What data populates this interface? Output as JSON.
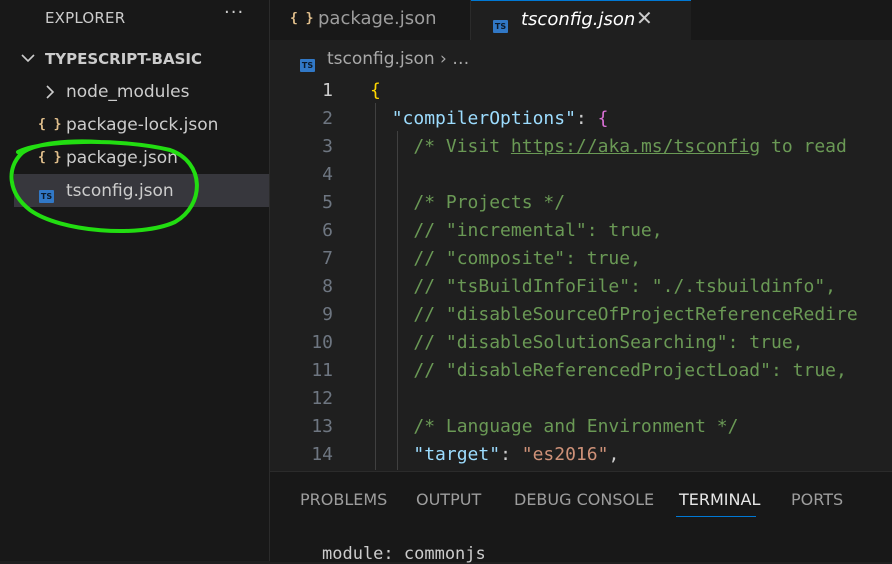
{
  "explorer": {
    "title": "EXPLORER",
    "more": "···",
    "folder": "TYPESCRIPT-BASIC",
    "items": [
      {
        "label": "node_modules",
        "type": "folder"
      },
      {
        "label": "package-lock.json",
        "type": "json"
      },
      {
        "label": "package.json",
        "type": "json"
      },
      {
        "label": "tsconfig.json",
        "type": "ts",
        "selected": true
      }
    ],
    "json_icon": "{ }",
    "ts_icon": "TS"
  },
  "tabs": [
    {
      "label": "package.json",
      "icon": "{ }"
    },
    {
      "label": "tsconfig.json",
      "icon": "TS",
      "active": true,
      "close": "✕"
    }
  ],
  "breadcrumb": {
    "file": "tsconfig.json",
    "sep": "› …"
  },
  "editor": {
    "line_numbers": [
      "1",
      "2",
      "3",
      "4",
      "5",
      "6",
      "7",
      "8",
      "9",
      "10",
      "11",
      "12",
      "13",
      "14"
    ],
    "lines": [
      {
        "parts": [
          {
            "t": "{",
            "c": "c-brace"
          }
        ]
      },
      {
        "parts": [
          {
            "t": "  "
          },
          {
            "t": "\"compilerOptions\"",
            "c": "c-key"
          },
          {
            "t": ": "
          },
          {
            "t": "{",
            "c": "c-brace2"
          }
        ]
      },
      {
        "parts": [
          {
            "t": "    "
          },
          {
            "t": "/* Visit ",
            "c": "c-com"
          },
          {
            "t": "https://aka.ms/tsconfig",
            "c": "c-link"
          },
          {
            "t": " to read",
            "c": "c-com"
          }
        ]
      },
      {
        "parts": [
          {
            "t": ""
          }
        ]
      },
      {
        "parts": [
          {
            "t": "    "
          },
          {
            "t": "/* Projects */",
            "c": "c-com"
          }
        ]
      },
      {
        "parts": [
          {
            "t": "    "
          },
          {
            "t": "// \"incremental\": true,",
            "c": "c-com"
          }
        ]
      },
      {
        "parts": [
          {
            "t": "    "
          },
          {
            "t": "// \"composite\": true,",
            "c": "c-com"
          }
        ]
      },
      {
        "parts": [
          {
            "t": "    "
          },
          {
            "t": "// \"tsBuildInfoFile\": \"./.tsbuildinfo\",",
            "c": "c-com"
          }
        ]
      },
      {
        "parts": [
          {
            "t": "    "
          },
          {
            "t": "// \"disableSourceOfProjectReferenceRedire",
            "c": "c-com"
          }
        ]
      },
      {
        "parts": [
          {
            "t": "    "
          },
          {
            "t": "// \"disableSolutionSearching\": true,",
            "c": "c-com"
          }
        ]
      },
      {
        "parts": [
          {
            "t": "    "
          },
          {
            "t": "// \"disableReferencedProjectLoad\": true,",
            "c": "c-com"
          }
        ]
      },
      {
        "parts": [
          {
            "t": ""
          }
        ]
      },
      {
        "parts": [
          {
            "t": "    "
          },
          {
            "t": "/* Language and Environment */",
            "c": "c-com"
          }
        ]
      },
      {
        "parts": [
          {
            "t": "    "
          },
          {
            "t": "\"target\"",
            "c": "c-key"
          },
          {
            "t": ": "
          },
          {
            "t": "\"es2016\"",
            "c": "c-str"
          },
          {
            "t": ","
          }
        ]
      }
    ]
  },
  "panel": {
    "tabs": [
      "PROBLEMS",
      "OUTPUT",
      "DEBUG CONSOLE",
      "TERMINAL",
      "PORTS"
    ],
    "active": "TERMINAL",
    "terminal_line": "module: commonjs"
  },
  "colors": {
    "accent": "#0078d4",
    "annotation": "#22dd11",
    "ts_badge": "#3178c6"
  }
}
